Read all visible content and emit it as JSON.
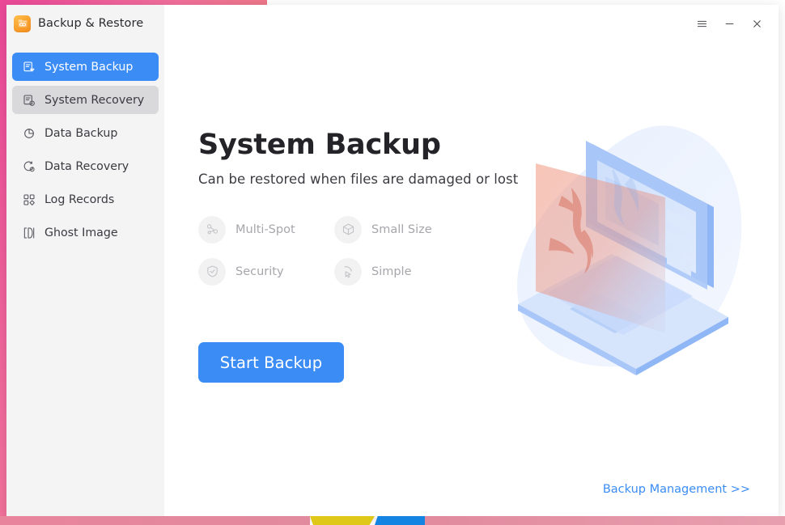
{
  "window": {
    "app_title": "Backup & Restore",
    "app_icon": "backup-restore-app-icon",
    "controls": {
      "menu_label": "☰",
      "menu_icon": "hamburger-menu-icon",
      "minimize_label": "−",
      "minimize_icon": "minimize-icon",
      "close_label": "✕",
      "close_icon": "close-icon"
    }
  },
  "sidebar": {
    "items": [
      {
        "label": "System Backup",
        "icon": "system-backup-icon",
        "state": "active"
      },
      {
        "label": "System Recovery",
        "icon": "system-recovery-icon",
        "state": "hovered"
      },
      {
        "label": "Data Backup",
        "icon": "data-backup-icon",
        "state": "normal"
      },
      {
        "label": "Data Recovery",
        "icon": "data-recovery-icon",
        "state": "normal"
      },
      {
        "label": "Log Records",
        "icon": "log-records-icon",
        "state": "normal"
      },
      {
        "label": "Ghost Image",
        "icon": "ghost-image-icon",
        "state": "normal"
      }
    ]
  },
  "main": {
    "title": "System Backup",
    "subtitle": "Can be restored when files are damaged or lost",
    "features": [
      {
        "label": "Multi-Spot",
        "icon": "share-nodes-icon"
      },
      {
        "label": "Small Size",
        "icon": "cube-icon"
      },
      {
        "label": "Security",
        "icon": "shield-check-icon"
      },
      {
        "label": "Simple",
        "icon": "cursor-pointer-icon"
      }
    ],
    "primary_button": "Start Backup",
    "footer_link": "Backup Management >>",
    "illustration": "isometric-laptop-backup-illustration"
  },
  "colors": {
    "accent": "#3b8cf5",
    "sidebar_bg": "#f4f4f5",
    "sidebar_hover": "#d9d9dc",
    "title_text": "#232328",
    "muted_text": "#a6a6ab",
    "brand_orange": "#f99f2c",
    "desktop_pink": "#ec4899",
    "desktop_orange": "#e8795f"
  }
}
